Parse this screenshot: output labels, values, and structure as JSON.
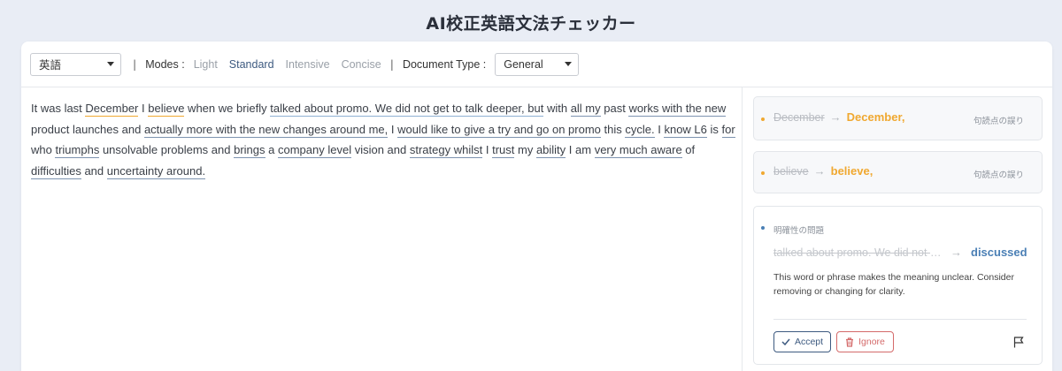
{
  "header": {
    "title": "AI校正英語文法チェッカー"
  },
  "toolbar": {
    "language": "英語",
    "sep1": "|",
    "modes_label": "Modes :",
    "modes": [
      "Light",
      "Standard",
      "Intensive",
      "Concise"
    ],
    "active_mode": "Standard",
    "sep2": "|",
    "doc_type_label": "Document Type :",
    "doc_type": "General"
  },
  "editor": {
    "segments": [
      {
        "t": "It was last ",
        "u": ""
      },
      {
        "t": "December",
        "u": "orange"
      },
      {
        "t": " I ",
        "u": ""
      },
      {
        "t": "believe",
        "u": "orange"
      },
      {
        "t": " when we briefly ",
        "u": ""
      },
      {
        "t": "talked about promo. We did not get to talk deeper, but",
        "u": "blue"
      },
      {
        "t": " with ",
        "u": ""
      },
      {
        "t": "all my",
        "u": "dark"
      },
      {
        "t": " past ",
        "u": ""
      },
      {
        "t": "works with the new",
        "u": "dark"
      },
      {
        "t": " product launches and ",
        "u": ""
      },
      {
        "t": "actually more with the new changes around me,",
        "u": "dark"
      },
      {
        "t": " I ",
        "u": ""
      },
      {
        "t": "would like to give a try and go on promo",
        "u": "dark"
      },
      {
        "t": " this ",
        "u": ""
      },
      {
        "t": "cycle.",
        "u": "dark"
      },
      {
        "t": " I ",
        "u": ""
      },
      {
        "t": "know L6",
        "u": "dark"
      },
      {
        "t": " is ",
        "u": ""
      },
      {
        "t": "for",
        "u": "dark"
      },
      {
        "t": " who ",
        "u": ""
      },
      {
        "t": "triumphs",
        "u": "dark"
      },
      {
        "t": " unsolvable problems and ",
        "u": ""
      },
      {
        "t": "brings",
        "u": "dark"
      },
      {
        "t": " a ",
        "u": ""
      },
      {
        "t": "company level",
        "u": "dark"
      },
      {
        "t": " vision and ",
        "u": ""
      },
      {
        "t": "strategy whilst",
        "u": "dark"
      },
      {
        "t": " I ",
        "u": ""
      },
      {
        "t": "trust",
        "u": "dark"
      },
      {
        "t": " my ",
        "u": ""
      },
      {
        "t": "ability",
        "u": "dark"
      },
      {
        "t": " I am ",
        "u": ""
      },
      {
        "t": "very much aware",
        "u": "dark"
      },
      {
        "t": " of ",
        "u": ""
      },
      {
        "t": "difficulties",
        "u": "dark"
      },
      {
        "t": " and ",
        "u": ""
      },
      {
        "t": "uncertainty around.",
        "u": "dark"
      }
    ]
  },
  "suggestions": [
    {
      "original": "December",
      "replacement": "December,",
      "category": "句読点の誤り"
    },
    {
      "original": "believe",
      "replacement": "believe,",
      "category": "句読点の誤り"
    },
    {
      "category": "明確性の問題",
      "original": "talked about promo. We did not get to talk deeper, but",
      "replacement": "discussed",
      "description": "This word or phrase makes the meaning unclear. Consider removing or changing for clarity.",
      "accept_label": "Accept",
      "ignore_label": "Ignore"
    }
  ],
  "colors": {
    "accent": "#3d5a80",
    "orange": "#f0a830",
    "blue": "#4a7fb5",
    "danger": "#d46a6a"
  }
}
